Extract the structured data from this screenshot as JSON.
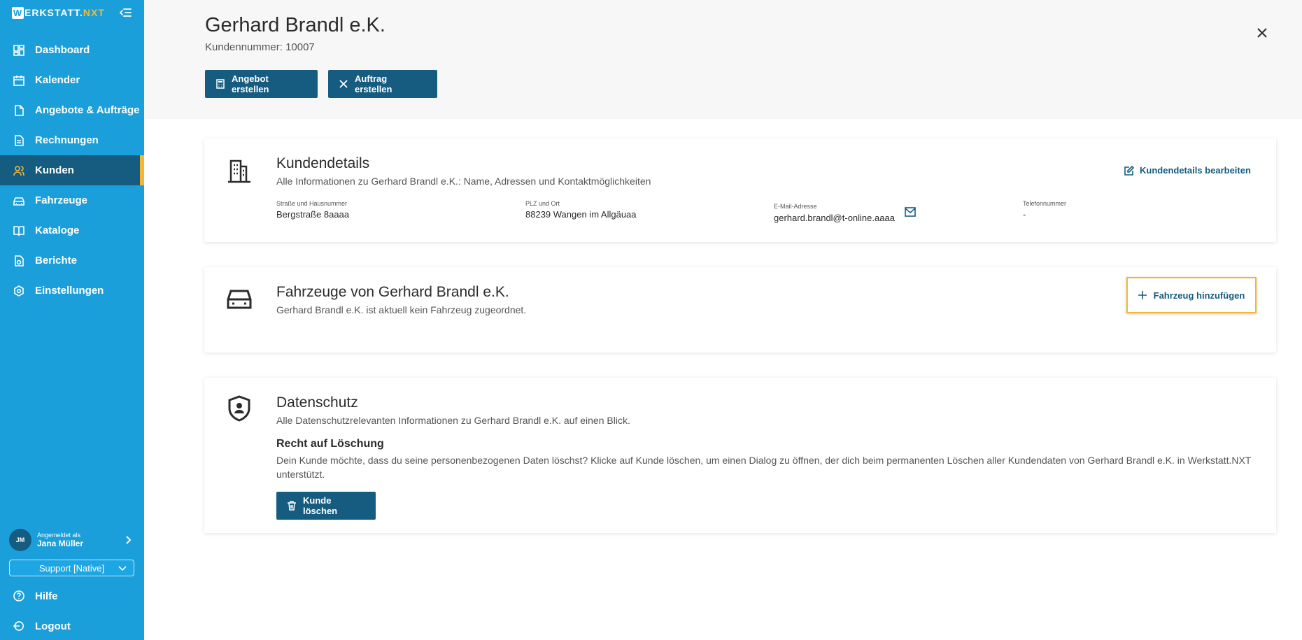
{
  "sidebar": {
    "logo_w": "W",
    "logo_main": "ERKSTATT.",
    "logo_accent": "NXT",
    "items": [
      {
        "label": "Dashboard",
        "icon": "dashboard-icon"
      },
      {
        "label": "Kalender",
        "icon": "calendar-icon"
      },
      {
        "label": "Angebote & Aufträge",
        "icon": "document-icon"
      },
      {
        "label": "Rechnungen",
        "icon": "invoice-icon"
      },
      {
        "label": "Kunden",
        "icon": "users-icon",
        "active": true
      },
      {
        "label": "Fahrzeuge",
        "icon": "car-icon"
      },
      {
        "label": "Kataloge",
        "icon": "book-icon"
      },
      {
        "label": "Berichte",
        "icon": "report-icon"
      },
      {
        "label": "Einstellungen",
        "icon": "gear-icon"
      }
    ],
    "user": {
      "label": "Angemeldet als",
      "name": "Jana Müller",
      "initials": "JM"
    },
    "support": "Support [Native]",
    "help": "Hilfe",
    "logout": "Logout"
  },
  "header": {
    "title": "Gerhard Brandl e.K.",
    "subtitle": "Kundennummer: 10007",
    "btn_offer": "Angebot erstellen",
    "btn_order": "Auftrag erstellen"
  },
  "details": {
    "title": "Kundendetails",
    "desc": "Alle Informationen zu Gerhard Brandl e.K.: Name, Adressen und Kontaktmöglichkeiten",
    "edit": "Kundendetails bearbeiten",
    "street_label": "Straße und Hausnummer",
    "street_value": "Bergstraße 8aaaa",
    "city_label": "PLZ und Ort",
    "city_value": "88239 Wangen im Allgäuaa",
    "email_label": "E-Mail-Adresse",
    "email_value": "gerhard.brandl@t-online.aaaa",
    "phone_label": "Telefonnummer",
    "phone_value": "-"
  },
  "vehicles": {
    "title": "Fahrzeuge von Gerhard Brandl e.K.",
    "desc": "Gerhard Brandl e.K. ist aktuell kein Fahrzeug zugeordnet.",
    "add": "Fahrzeug hinzufügen"
  },
  "privacy": {
    "title": "Datenschutz",
    "desc": "Alle Datenschutzrelevanten Informationen zu Gerhard Brandl e.K. auf einen Blick.",
    "section_title": "Recht auf Löschung",
    "section_text": "Dein Kunde möchte, dass du seine personenbezogenen Daten löschst? Klicke auf Kunde löschen, um einen Dialog zu öffnen, der dich beim permanenten Löschen aller Kundendaten von Gerhard Brandl e.K. in Werkstatt.NXT unterstützt.",
    "delete": "Kunde löschen"
  },
  "colors": {
    "sidebar": "#1a9fdb",
    "dark": "#155c80",
    "accent": "#f5b731"
  }
}
